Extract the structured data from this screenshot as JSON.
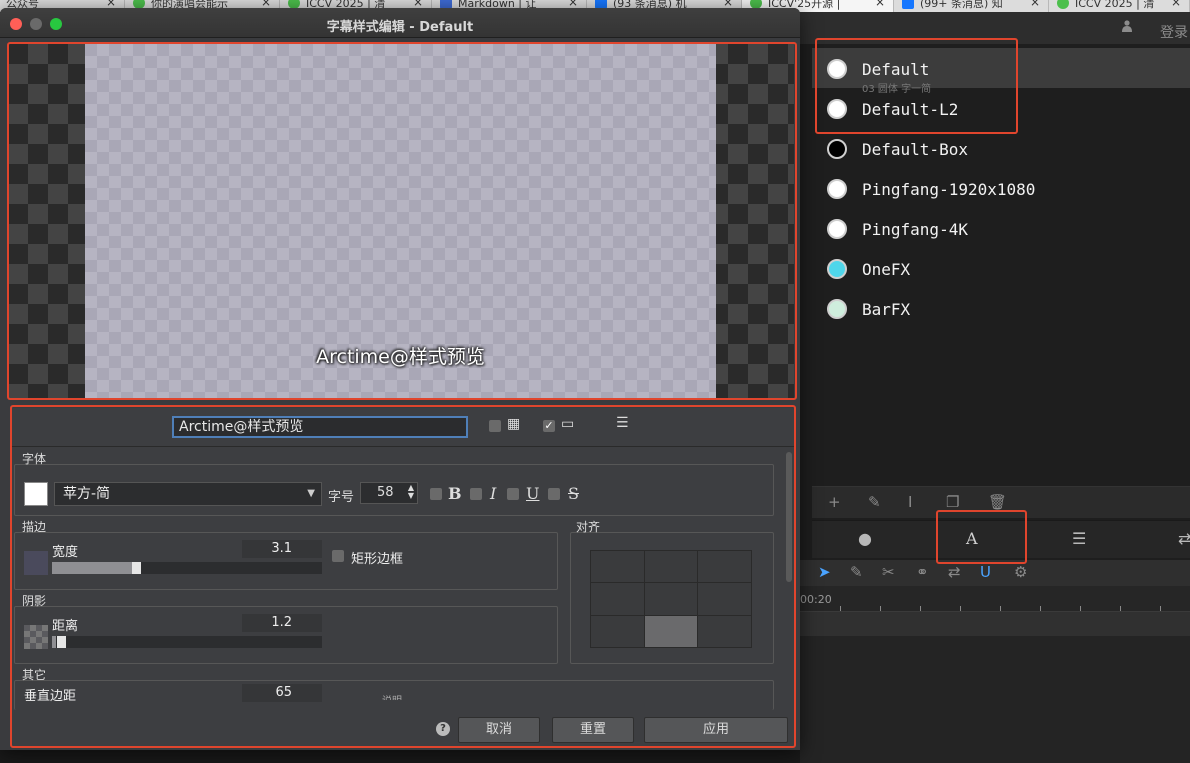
{
  "browser_tabs": [
    {
      "label": "公众号"
    },
    {
      "label": "你的演唱会能示"
    },
    {
      "label": "ICCV 2025 | 清"
    },
    {
      "label": "Markdown | 让"
    },
    {
      "label": "(93 条消息) 机"
    },
    {
      "label": "ICCV'25开源 |"
    },
    {
      "label": "(99+ 条消息) 知"
    },
    {
      "label": "ICCV 2025 | 清"
    }
  ],
  "app": {
    "login_label": "登录",
    "styles": [
      {
        "name": "Default",
        "dot_color": "#ffffff",
        "selected": true
      },
      {
        "name": "Default-L2",
        "dot_color": "#ffffff"
      },
      {
        "name": "Default-Box",
        "dot_color": "#000000"
      },
      {
        "name": "Pingfang-1920x1080",
        "dot_color": "#ffffff"
      },
      {
        "name": "Pingfang-4K",
        "dot_color": "#ffffff"
      },
      {
        "name": "OneFX",
        "dot_color": "#4fd6ea"
      },
      {
        "name": "BarFX",
        "dot_color": "#cfeedd"
      }
    ],
    "selected_sub": "03 圆体 字一简",
    "ruler_time": "00:20"
  },
  "dialog": {
    "title": "字幕样式编辑 - Default",
    "preview_text": "Arctime@样式预览",
    "text_input_value": "Arctime@样式预览",
    "font": {
      "section_label": "字体",
      "font_name": "苹方-简",
      "size_label": "字号",
      "size_value": "58",
      "bold": "B",
      "italic": "I",
      "underline": "U",
      "strike": "S",
      "color": "#ffffff"
    },
    "stroke": {
      "section_label": "描边",
      "width_label": "宽度",
      "width_value": "3.1",
      "rect_border_label": "矩形边框"
    },
    "shadow": {
      "section_label": "阴影",
      "distance_label": "距离",
      "distance_value": "1.2"
    },
    "align": {
      "section_label": "对齐"
    },
    "other": {
      "section_label": "其它",
      "vmargin_label": "垂直边距",
      "vmargin_value": "65",
      "cut_label": "说明"
    },
    "buttons": {
      "cancel": "取消",
      "reset": "重置",
      "apply": "应用"
    }
  }
}
